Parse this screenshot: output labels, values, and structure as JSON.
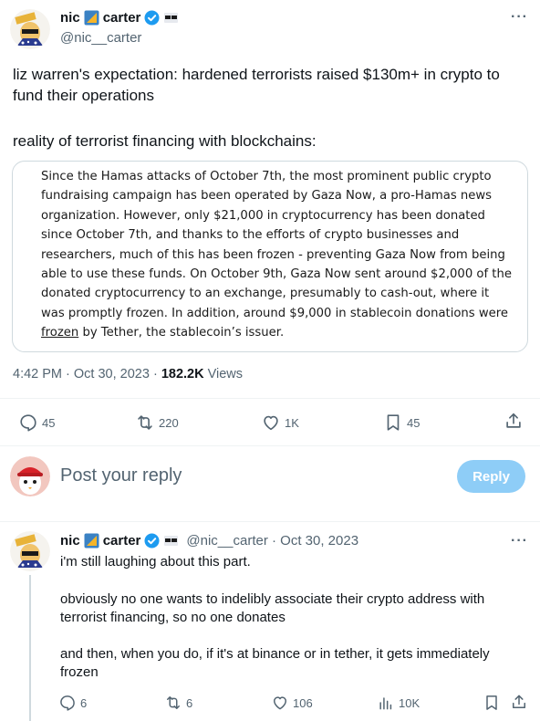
{
  "tweet": {
    "author_name_first": "nic",
    "author_name_last": "carter",
    "handle": "@nic__carter",
    "more_label": "···",
    "text_p1": "liz warren's expectation: hardened terrorists raised $130m+ in crypto to fund their operations",
    "text_p2": "reality of terrorist financing with blockchains:",
    "quote": {
      "line1": "Since the Hamas attacks of October 7th, the most prominent public crypto",
      "line2": "fundraising campaign has been operated by Gaza Now, a pro-Hamas news",
      "line3": "organization. However, only $21,000 in cryptocurrency has been donated",
      "line4": "since October 7th, and thanks to the efforts of crypto businesses and",
      "line5": "researchers, much of this has been frozen - preventing Gaza Now from being",
      "line6": "able to use these funds. On October 9th, Gaza Now sent around $2,000 of the",
      "line7": "donated cryptocurrency to an exchange, presumably to cash-out, where it",
      "line8": "was promptly frozen. In addition, around $9,000 in stablecoin donations were",
      "line9_link": "frozen",
      "line9_rest": " by Tether, the stablecoin’s issuer."
    },
    "time": "4:42 PM · Oct 30, 2023 · ",
    "views_count": "182.2K",
    "views_label": " Views",
    "actions": {
      "replies": "45",
      "retweets": "220",
      "likes": "1K",
      "bookmarks": "45"
    }
  },
  "compose": {
    "placeholder": "Post your reply",
    "reply_button": "Reply"
  },
  "reply": {
    "author_name_first": "nic",
    "author_name_last": "carter",
    "handle_date": "@nic__carter · Oct 30, 2023",
    "more_label": "···",
    "p1": "i'm still laughing about this part.",
    "p2": "obviously no one wants to indelibly associate their crypto address with terrorist financing, so no one donates",
    "p3": "and then, when you do, if it's at binance or in tether, it gets immediately frozen",
    "actions": {
      "replies": "6",
      "retweets": "6",
      "likes": "106",
      "views": "10K"
    }
  },
  "colors": {
    "verified_blue": "#1d9bf0",
    "reply_button_bg": "#8ecdf7",
    "muted_text": "#536471"
  }
}
